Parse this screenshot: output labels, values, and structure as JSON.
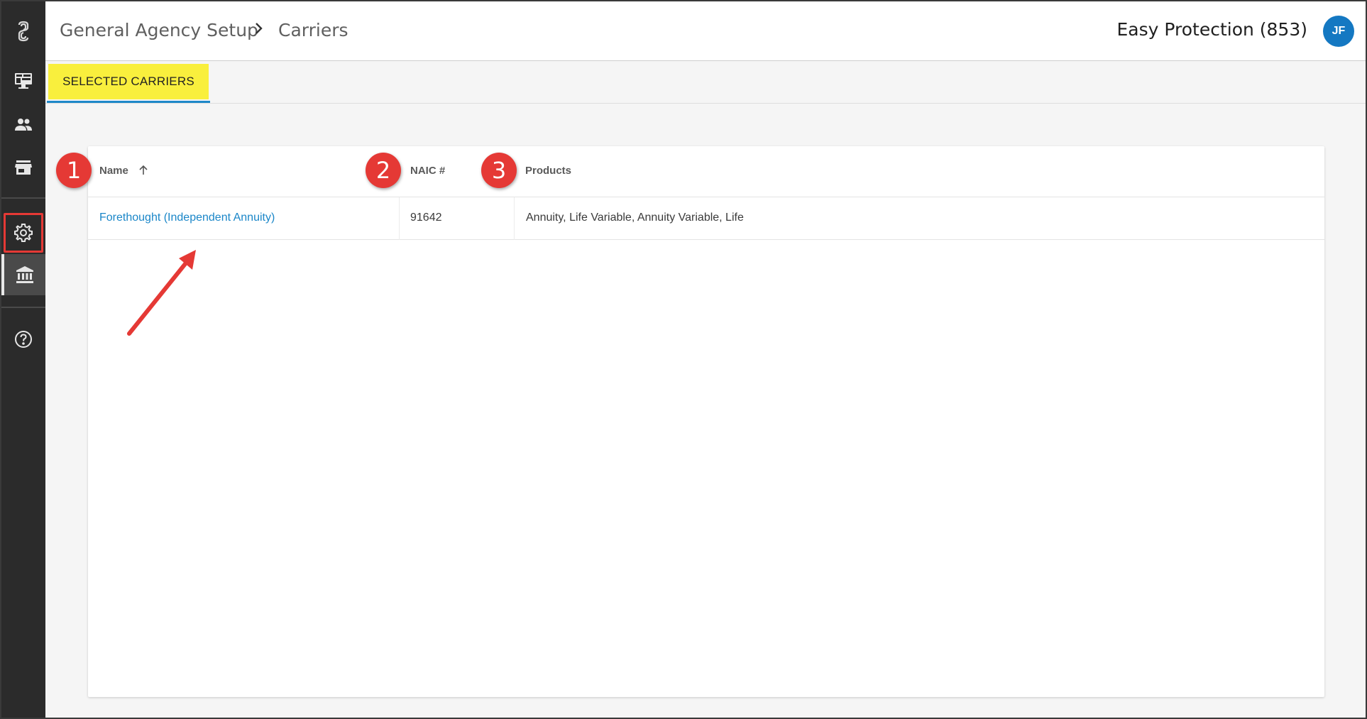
{
  "sidebar": {
    "items": [
      {
        "icon": "app-logo-icon"
      },
      {
        "icon": "dashboard-icon"
      },
      {
        "icon": "people-icon"
      },
      {
        "icon": "store-icon"
      },
      {
        "icon": "gear-icon",
        "highlighted": true
      },
      {
        "icon": "bank-icon",
        "active": true
      },
      {
        "icon": "help-icon"
      }
    ]
  },
  "header": {
    "breadcrumb": [
      "General Agency Setup",
      "Carriers"
    ],
    "agency_name": "Easy Protection (853)",
    "avatar_initials": "JF"
  },
  "tabs": [
    {
      "label": "SELECTED CARRIERS",
      "active": true
    }
  ],
  "table": {
    "columns": [
      "Name",
      "NAIC #",
      "Products"
    ],
    "rows": [
      {
        "name": "Forethought (Independent Annuity)",
        "naic": "91642",
        "products": "Annuity, Life Variable, Annuity Variable, Life"
      }
    ]
  },
  "annotations": {
    "badges": [
      "1",
      "2",
      "3"
    ]
  },
  "colors": {
    "sidebar_bg": "#2b2b2b",
    "accent": "#1a86c8",
    "tab_highlight": "#f9ef3d",
    "annotation": "#e53935"
  }
}
